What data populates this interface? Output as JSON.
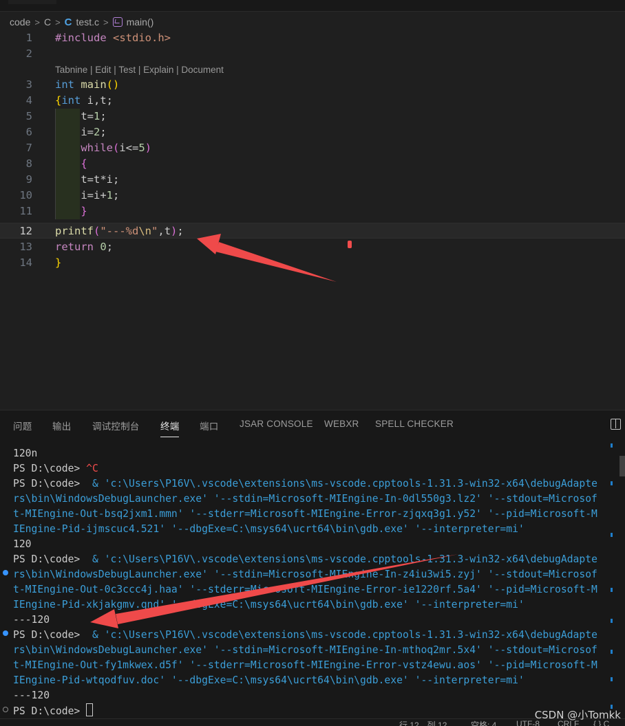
{
  "breadcrumb": {
    "folder": "code",
    "sub": "C",
    "file": "test.c",
    "symbol": "main()",
    "sep": ">"
  },
  "editor": {
    "codelens": "Tabnine | Edit | Test | Explain | Document",
    "line_numbers": [
      "1",
      "2",
      "3",
      "4",
      "5",
      "6",
      "7",
      "8",
      "9",
      "10",
      "11",
      "12",
      "13",
      "14"
    ],
    "active_line": "12"
  },
  "panel": {
    "tabs": [
      "问题",
      "输出",
      "调试控制台",
      "终端",
      "端口",
      "JSAR CONSOLE",
      "WEBXR",
      "SPELL CHECKER"
    ],
    "active_tab": "终端"
  },
  "terminal": {
    "lines": [
      {
        "prompt": "",
        "text": "120n"
      },
      {
        "prompt": "PS D:\\code> ",
        "text": "^C"
      },
      {
        "prompt": "PS D:\\code> ",
        "text": " & 'c:\\Users\\P16V\\.vscode\\extensions\\ms-vscode.cpptools-1.31.3-win32-x64\\debugAdapte"
      },
      {
        "prompt": "",
        "text": "rs\\bin\\WindowsDebugLauncher.exe' '--stdin=Microsoft-MIEngine-In-0dl550g3.lz2' '--stdout=Microsof"
      },
      {
        "prompt": "",
        "text": "t-MIEngine-Out-bsq2jxm1.mmn' '--stderr=Microsoft-MIEngine-Error-zjqxq3g1.y52' '--pid=Microsoft-M"
      },
      {
        "prompt": "",
        "text": "IEngine-Pid-ijmscuc4.521' '--dbgExe=C:\\msys64\\ucrt64\\bin\\gdb.exe' '--interpreter=mi'"
      },
      {
        "prompt": "",
        "text": "120"
      },
      {
        "prompt": "PS D:\\code> ",
        "text": " & 'c:\\Users\\P16V\\.vscode\\extensions\\ms-vscode.cpptools-1.31.3-win32-x64\\debugAdapte"
      },
      {
        "prompt": "",
        "text": "rs\\bin\\WindowsDebugLauncher.exe' '--stdin=Microsoft-MIEngine-In-z4iu3wi5.zyj' '--stdout=Microsof"
      },
      {
        "prompt": "",
        "text": "t-MIEngine-Out-0c3ccc4j.haa' '--stderr=Microsoft-MIEngine-Error-ie1220rf.5a4' '--pid=Microsoft-M"
      },
      {
        "prompt": "",
        "text": "IEngine-Pid-xkjakgmv.qnd' '--dbgExe=C:\\msys64\\ucrt64\\bin\\gdb.exe' '--interpreter=mi'"
      },
      {
        "prompt": "",
        "text": "---120"
      },
      {
        "prompt": "PS D:\\code> ",
        "text": " & 'c:\\Users\\P16V\\.vscode\\extensions\\ms-vscode.cpptools-1.31.3-win32-x64\\debugAdapte"
      },
      {
        "prompt": "",
        "text": "rs\\bin\\WindowsDebugLauncher.exe' '--stdin=Microsoft-MIEngine-In-mthoq2mr.5x4' '--stdout=Microsof"
      },
      {
        "prompt": "",
        "text": "t-MIEngine-Out-fy1mkwex.d5f' '--stderr=Microsoft-MIEngine-Error-vstz4ewu.aos' '--pid=Microsoft-M"
      },
      {
        "prompt": "",
        "text": "IEngine-Pid-wtqodfuv.doc' '--dbgExe=C:\\msys64\\ucrt64\\bin\\gdb.exe' '--interpreter=mi'"
      },
      {
        "prompt": "",
        "text": "---120"
      },
      {
        "prompt": "PS D:\\code> ",
        "text": ""
      }
    ]
  },
  "watermark": "CSDN @小Tomkk",
  "statusbar": {
    "items": [
      "行 12，列 12",
      "空格: 4",
      "UTF-8",
      "CRLF",
      "{ } C"
    ]
  },
  "colors": {
    "editor_bg": "#1f1f1f",
    "panel_bg": "#181818",
    "arrow": "#ef4a4a",
    "keyword": "#569cd6",
    "string": "#ce9178"
  }
}
